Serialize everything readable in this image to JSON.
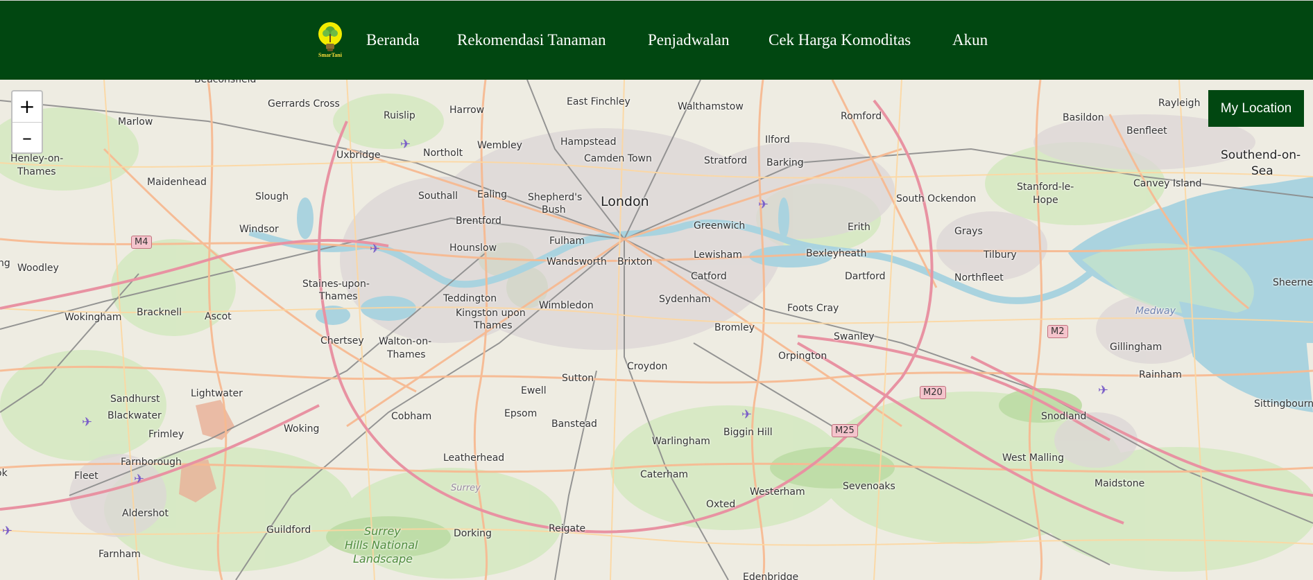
{
  "app": {
    "logo_text": "SmarTani"
  },
  "nav": {
    "items": [
      {
        "label": "Beranda"
      },
      {
        "label": "Rekomendasi Tanaman"
      },
      {
        "label": "Penjadwalan"
      },
      {
        "label": "Cek Harga Komoditas"
      },
      {
        "label": "Akun"
      }
    ]
  },
  "map": {
    "zoom_in": "+",
    "zoom_out": "–",
    "my_location": "My Location",
    "places": {
      "beaconsfield": "Beaconsfield",
      "gerrards_cross": "Gerrards Cross",
      "marlow": "Marlow",
      "ruislip": "Ruislip",
      "harrow": "Harrow",
      "east_finchley": "East Finchley",
      "walthamstow": "Walthamstow",
      "romford": "Romford",
      "rayleigh": "Rayleigh",
      "basildon": "Basildon",
      "benfleet": "Benfleet",
      "henley1": "Henley-on-",
      "henley2": "Thames",
      "uxbridge": "Uxbridge",
      "northolt": "Northolt",
      "wembley": "Wembley",
      "hampstead": "Hampstead",
      "camden": "Camden Town",
      "ilford": "Ilford",
      "stratford": "Stratford",
      "barking": "Barking",
      "southend1": "Southend-on-",
      "southend2": "Sea",
      "maidenhead": "Maidenhead",
      "slough": "Slough",
      "southall": "Southall",
      "ealing": "Ealing",
      "shepherds1": "Shepherd's",
      "shepherds2": "Bush",
      "london": "London",
      "south_ockendon": "South Ockendon",
      "stanford1": "Stanford-le-",
      "stanford2": "Hope",
      "canvey": "Canvey Island",
      "windsor": "Windsor",
      "brentford": "Brentford",
      "greenwich": "Greenwich",
      "erith": "Erith",
      "grays": "Grays",
      "tilbury": "Tilbury",
      "hounslow": "Hounslow",
      "fulham": "Fulham",
      "lewisham": "Lewisham",
      "bexleyheath": "Bexleyheath",
      "woodley": "Woodley",
      "wandsworth": "Wandsworth",
      "brixton": "Brixton",
      "catford": "Catford",
      "dartford": "Dartford",
      "northfleet": "Northfleet",
      "sheerness": "Sheerne",
      "staines1": "Staines-upon-",
      "staines2": "Thames",
      "teddington": "Teddington",
      "sydenham": "Sydenham",
      "wokingham": "Wokingham",
      "bracknell": "Bracknell",
      "ascot": "Ascot",
      "kingston1": "Kingston upon",
      "kingston2": "Thames",
      "wimbledon": "Wimbledon",
      "foots_cray": "Foots Cray",
      "medway": "Medway",
      "bromley": "Bromley",
      "chertsey": "Chertsey",
      "walton1": "Walton-on-",
      "walton2": "Thames",
      "swanley": "Swanley",
      "gillingham": "Gillingham",
      "orpington": "Orpington",
      "croydon": "Croydon",
      "rainham": "Rainham",
      "sutton": "Sutton",
      "sandhurst": "Sandhurst",
      "lightwater": "Lightwater",
      "ewell": "Ewell",
      "blackwater": "Blackwater",
      "cobham": "Cobham",
      "epsom": "Epsom",
      "sittingbourne": "Sittingbourne",
      "snodland": "Snodland",
      "banstead": "Banstead",
      "woking": "Woking",
      "biggin_hill": "Biggin Hill",
      "frimley": "Frimley",
      "warlingham": "Warlingham",
      "farnborough": "Farnborough",
      "leatherhead": "Leatherhead",
      "west_malling": "West Malling",
      "fleet": "Fleet",
      "caterham": "Caterham",
      "surrey": "Surrey",
      "sevenoaks": "Sevenoaks",
      "maidstone": "Maidstone",
      "westerham": "Westerham",
      "oxted": "Oxted",
      "aldershot": "Aldershot",
      "surrey_hills1": "Surrey",
      "surrey_hills2": "Hills National",
      "surrey_hills3": "Landscape",
      "guildford": "Guildford",
      "dorking": "Dorking",
      "reigate": "Reigate",
      "farnham": "Farnham",
      "edenbridge": "Edenbridge",
      "ok": "ok",
      "ng": "ng"
    },
    "shields": {
      "m4": "M4",
      "m2": "M2",
      "m20": "M20",
      "m25": "M25"
    }
  }
}
